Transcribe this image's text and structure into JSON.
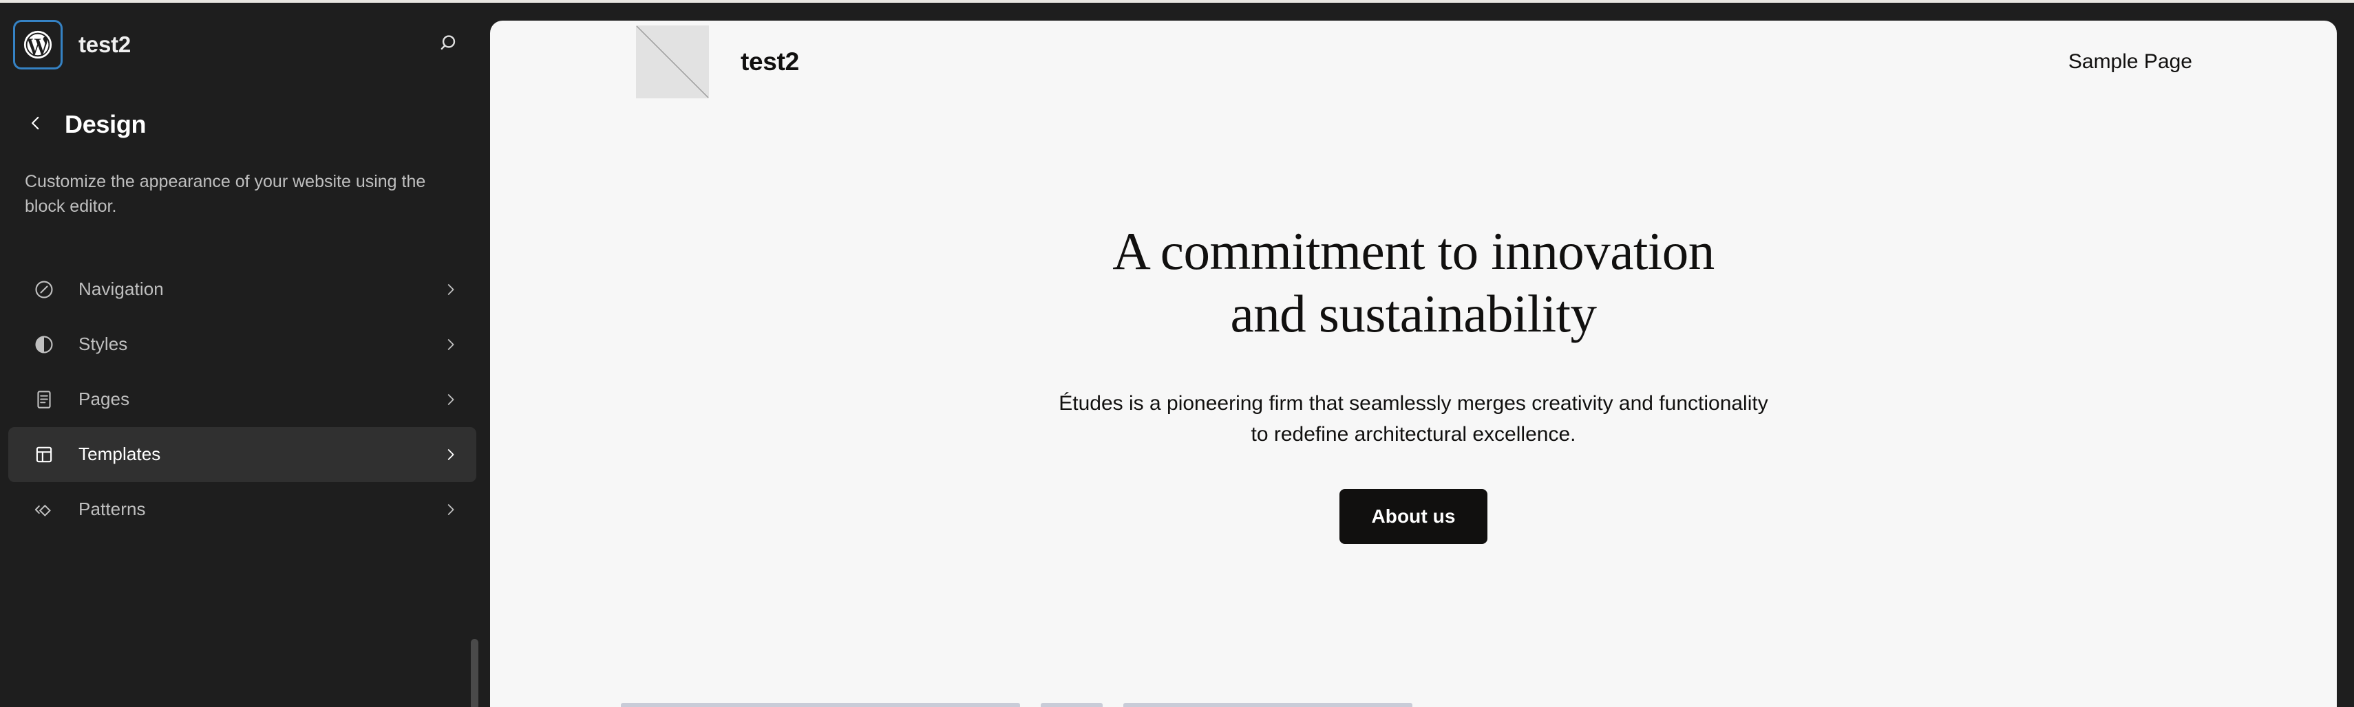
{
  "app": {
    "name": "WordPress Site Editor",
    "site_title": "test2"
  },
  "sidebar": {
    "logo_icon": "wordpress-logo-icon",
    "site_title": "test2",
    "search_icon": "search-icon",
    "back_icon": "chevron-left-icon",
    "title": "Design",
    "description": "Customize the appearance of your website using the block editor.",
    "items": [
      {
        "label": "Navigation",
        "icon": "compass-icon",
        "chevron": "chevron-right-icon",
        "active": false
      },
      {
        "label": "Styles",
        "icon": "half-circle-contrast-icon",
        "chevron": "chevron-right-icon",
        "active": false
      },
      {
        "label": "Pages",
        "icon": "page-document-icon",
        "chevron": "chevron-right-icon",
        "active": false
      },
      {
        "label": "Templates",
        "icon": "layout-template-icon",
        "chevron": "chevron-right-icon",
        "active": true
      },
      {
        "label": "Patterns",
        "icon": "diamond-chevrons-icon",
        "chevron": "chevron-right-icon",
        "active": false
      }
    ]
  },
  "canvas": {
    "site_header": {
      "logo_icon": "image-placeholder-icon",
      "brand_name": "test2",
      "nav_links": [
        "Sample Page"
      ]
    },
    "hero": {
      "title_line_1": "A commitment to innovation",
      "title_line_2": "and sustainability",
      "subtitle": "Études is a pioneering firm that seamlessly merges creativity and functionality to redefine architectural excellence.",
      "cta_label": "About us"
    }
  },
  "colors": {
    "sidebar_bg": "#1e1e1e",
    "sidebar_active_bg": "#303030",
    "sidebar_text": "#bfbfbf",
    "sidebar_text_active": "#ffffff",
    "focus_ring": "#3582c4",
    "canvas_bg": "#f7f7f7",
    "ink": "#11100f",
    "cta_bg": "#11100f",
    "scrollbar": "#4a4a4a"
  }
}
